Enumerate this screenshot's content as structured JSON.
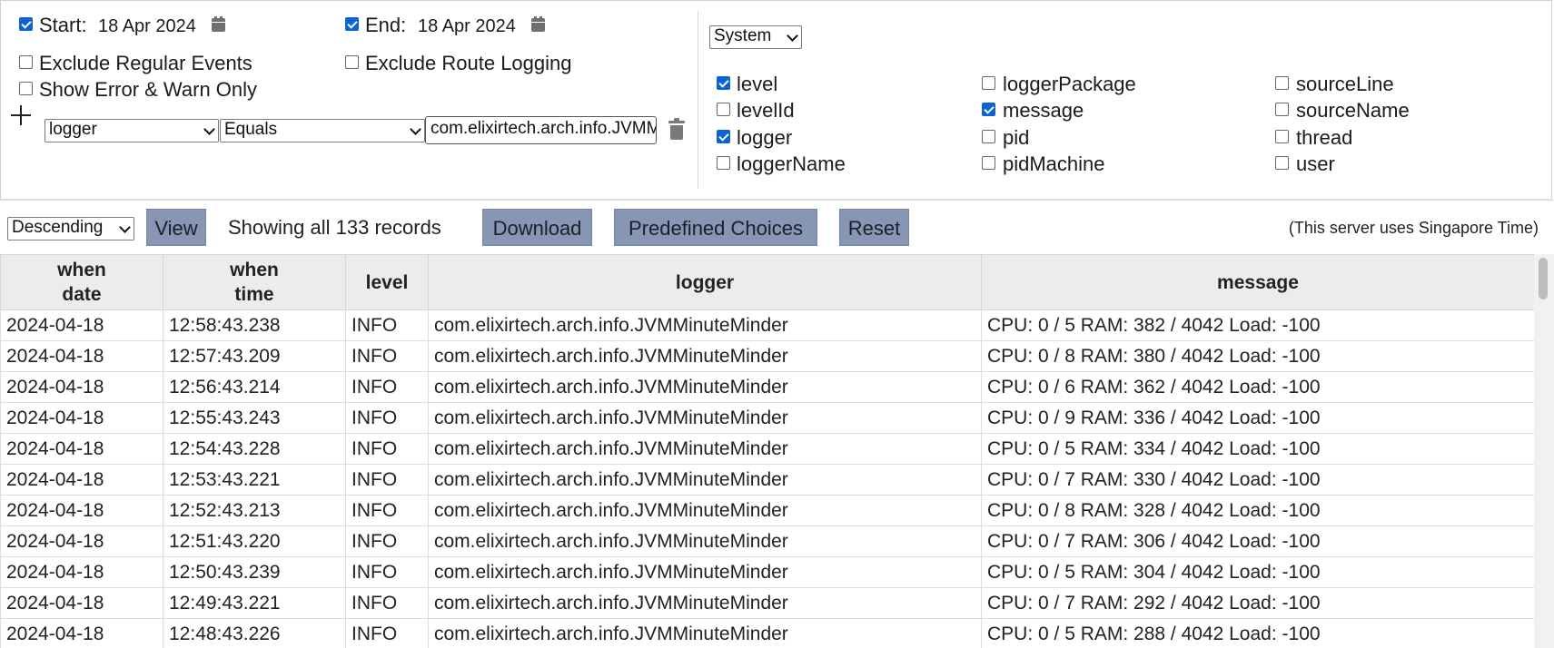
{
  "filters": {
    "start": {
      "checked": true,
      "label": "Start:",
      "date": "18 Apr 2024"
    },
    "end": {
      "checked": true,
      "label": "End:",
      "date": "18 Apr 2024"
    },
    "exclude_regular_events": {
      "checked": false,
      "label": "Exclude Regular Events"
    },
    "exclude_route_logging": {
      "checked": false,
      "label": "Exclude Route Logging"
    },
    "show_error_warn_only": {
      "checked": false,
      "label": "Show Error & Warn Only"
    },
    "condition": {
      "field": "logger",
      "operator": "Equals",
      "value": "com.elixirtech.arch.info.JVMMinuteMinder"
    }
  },
  "columns_panel": {
    "preset": "System",
    "fields": [
      {
        "name": "level",
        "checked": true
      },
      {
        "name": "levelId",
        "checked": false
      },
      {
        "name": "logger",
        "checked": true
      },
      {
        "name": "loggerName",
        "checked": false
      },
      {
        "name": "loggerPackage",
        "checked": false
      },
      {
        "name": "message",
        "checked": true
      },
      {
        "name": "pid",
        "checked": false
      },
      {
        "name": "pidMachine",
        "checked": false
      },
      {
        "name": "sourceLine",
        "checked": false
      },
      {
        "name": "sourceName",
        "checked": false
      },
      {
        "name": "thread",
        "checked": false
      },
      {
        "name": "user",
        "checked": false
      }
    ]
  },
  "toolbar": {
    "order": "Descending",
    "view_label": "View",
    "status": "Showing all 133 records",
    "download_label": "Download",
    "predefined_label": "Predefined Choices",
    "reset_label": "Reset",
    "timezone_note": "(This server uses Singapore Time)"
  },
  "table": {
    "headers": [
      {
        "line1": "when",
        "line2": "date"
      },
      {
        "line1": "when",
        "line2": "time"
      },
      {
        "line1": "level",
        "line2": ""
      },
      {
        "line1": "logger",
        "line2": ""
      },
      {
        "line1": "message",
        "line2": ""
      }
    ],
    "rows": [
      [
        "2024-04-18",
        "12:58:43.238",
        "INFO",
        "com.elixirtech.arch.info.JVMMinuteMinder",
        "CPU: 0 / 5 RAM: 382 / 4042 Load: -100"
      ],
      [
        "2024-04-18",
        "12:57:43.209",
        "INFO",
        "com.elixirtech.arch.info.JVMMinuteMinder",
        "CPU: 0 / 8 RAM: 380 / 4042 Load: -100"
      ],
      [
        "2024-04-18",
        "12:56:43.214",
        "INFO",
        "com.elixirtech.arch.info.JVMMinuteMinder",
        "CPU: 0 / 6 RAM: 362 / 4042 Load: -100"
      ],
      [
        "2024-04-18",
        "12:55:43.243",
        "INFO",
        "com.elixirtech.arch.info.JVMMinuteMinder",
        "CPU: 0 / 9 RAM: 336 / 4042 Load: -100"
      ],
      [
        "2024-04-18",
        "12:54:43.228",
        "INFO",
        "com.elixirtech.arch.info.JVMMinuteMinder",
        "CPU: 0 / 5 RAM: 334 / 4042 Load: -100"
      ],
      [
        "2024-04-18",
        "12:53:43.221",
        "INFO",
        "com.elixirtech.arch.info.JVMMinuteMinder",
        "CPU: 0 / 7 RAM: 330 / 4042 Load: -100"
      ],
      [
        "2024-04-18",
        "12:52:43.213",
        "INFO",
        "com.elixirtech.arch.info.JVMMinuteMinder",
        "CPU: 0 / 8 RAM: 328 / 4042 Load: -100"
      ],
      [
        "2024-04-18",
        "12:51:43.220",
        "INFO",
        "com.elixirtech.arch.info.JVMMinuteMinder",
        "CPU: 0 / 7 RAM: 306 / 4042 Load: -100"
      ],
      [
        "2024-04-18",
        "12:50:43.239",
        "INFO",
        "com.elixirtech.arch.info.JVMMinuteMinder",
        "CPU: 0 / 5 RAM: 304 / 4042 Load: -100"
      ],
      [
        "2024-04-18",
        "12:49:43.221",
        "INFO",
        "com.elixirtech.arch.info.JVMMinuteMinder",
        "CPU: 0 / 7 RAM: 292 / 4042 Load: -100"
      ],
      [
        "2024-04-18",
        "12:48:43.226",
        "INFO",
        "com.elixirtech.arch.info.JVMMinuteMinder",
        "CPU: 0 / 5 RAM: 288 / 4042 Load: -100"
      ]
    ]
  },
  "colors": {
    "button_bg": "#8797b3",
    "checkbox_checked": "#0b63d6",
    "header_bg": "#ececec"
  }
}
